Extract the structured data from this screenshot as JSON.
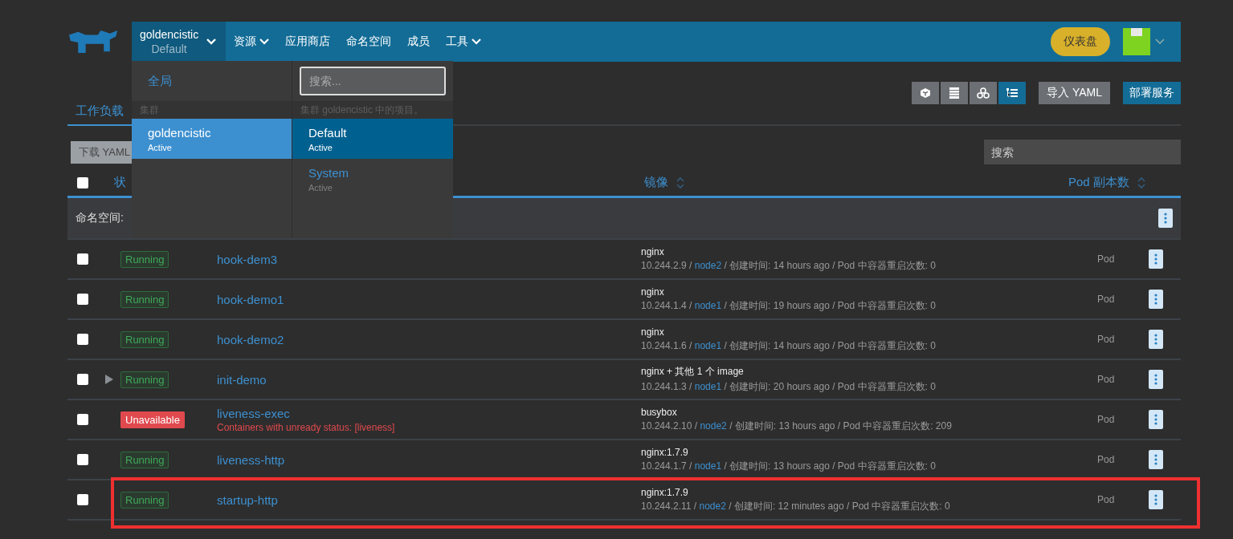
{
  "navbar": {
    "project": {
      "cluster": "goldencistic",
      "project": "Default"
    },
    "items": [
      {
        "label": "资源",
        "has_menu": true
      },
      {
        "label": "应用商店",
        "has_menu": false
      },
      {
        "label": "命名空间",
        "has_menu": false
      },
      {
        "label": "成员",
        "has_menu": false
      },
      {
        "label": "工具",
        "has_menu": true
      }
    ],
    "dashboard_button": "仪表盘"
  },
  "project_menu": {
    "global_link": "全局",
    "search": {
      "placeholder": "搜索..."
    },
    "cluster_header": "集群",
    "project_header": "集群 goldencistic 中的项目。",
    "clusters": [
      {
        "name": "goldencistic",
        "state": "Active",
        "selected": true
      }
    ],
    "projects": [
      {
        "name": "Default",
        "state": "Active",
        "selected": true
      },
      {
        "name": "System",
        "state": "Active",
        "selected": false
      }
    ]
  },
  "tabs": [
    {
      "label": "工作负载",
      "selected": true
    }
  ],
  "view_buttons": [
    {
      "kind": "cube",
      "selected": false
    },
    {
      "kind": "list",
      "selected": false
    },
    {
      "kind": "nodes",
      "selected": false
    },
    {
      "kind": "tree",
      "selected": true
    }
  ],
  "import_button": "导入 YAML",
  "deploy_button": "部署服务",
  "download_button": "下载 YAML",
  "search": {
    "placeholder": "搜索"
  },
  "table": {
    "select_all_checked": false,
    "columns": [
      {
        "label": "状"
      },
      {
        "label": "镜像",
        "sortable": true
      },
      {
        "label": "Pod 副本数",
        "sortable": true
      }
    ],
    "group": {
      "label": "命名空间:"
    },
    "rows": [
      {
        "checked": false,
        "status": {
          "label": "Running",
          "kind": "ok"
        },
        "expandable": false,
        "name": "hook-dem3",
        "image": "nginx",
        "ip": "10.244.2.9 /",
        "node": "node2",
        "detail": "/ 创建时间: 14 hours ago / Pod 中容器重启次数: 0",
        "type": "Pod",
        "highlighted": false
      },
      {
        "checked": false,
        "status": {
          "label": "Running",
          "kind": "ok"
        },
        "expandable": false,
        "name": "hook-demo1",
        "image": "nginx",
        "ip": "10.244.1.4 /",
        "node": "node1",
        "detail": "/ 创建时间: 19 hours ago / Pod 中容器重启次数: 0",
        "type": "Pod",
        "highlighted": false
      },
      {
        "checked": false,
        "status": {
          "label": "Running",
          "kind": "ok"
        },
        "expandable": false,
        "name": "hook-demo2",
        "image": "nginx",
        "ip": "10.244.1.6 /",
        "node": "node1",
        "detail": "/ 创建时间: 14 hours ago / Pod 中容器重启次数: 0",
        "type": "Pod",
        "highlighted": false
      },
      {
        "checked": false,
        "status": {
          "label": "Running",
          "kind": "ok"
        },
        "expandable": true,
        "name": "init-demo",
        "image": "nginx + 其他 1 个 image",
        "ip": "10.244.1.3 /",
        "node": "node1",
        "detail": "/ 创建时间: 20 hours ago / Pod 中容器重启次数: 0",
        "type": "Pod",
        "highlighted": false
      },
      {
        "checked": false,
        "status": {
          "label": "Unavailable",
          "kind": "error"
        },
        "expandable": false,
        "name": "liveness-exec",
        "error": "Containers with unready status: [liveness]",
        "image": "busybox",
        "ip": "10.244.2.10 /",
        "node": "node2",
        "detail": "/ 创建时间: 13 hours ago / Pod 中容器重启次数: 209",
        "type": "Pod",
        "highlighted": false
      },
      {
        "checked": false,
        "status": {
          "label": "Running",
          "kind": "ok"
        },
        "expandable": false,
        "name": "liveness-http",
        "image": "nginx:1.7.9",
        "ip": "10.244.1.7 /",
        "node": "node1",
        "detail": "/ 创建时间: 13 hours ago / Pod 中容器重启次数: 0",
        "type": "Pod",
        "highlighted": false
      },
      {
        "checked": false,
        "status": {
          "label": "Running",
          "kind": "ok"
        },
        "expandable": false,
        "name": "startup-http",
        "image": "nginx:1.7.9",
        "ip": "10.244.2.11 /",
        "node": "node2",
        "detail": "/ 创建时间: 12 minutes ago / Pod 中容器重启次数: 0",
        "type": "Pod",
        "highlighted": true
      }
    ]
  }
}
